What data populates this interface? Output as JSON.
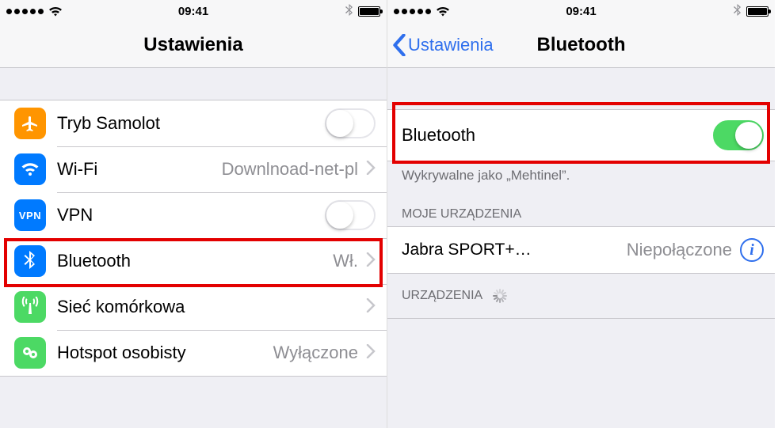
{
  "status": {
    "time": "09:41"
  },
  "left": {
    "title": "Ustawienia",
    "rows": {
      "airplane": {
        "label": "Tryb Samolot",
        "on": false
      },
      "wifi": {
        "label": "Wi-Fi",
        "value": "Downlnoad-net-pl"
      },
      "vpn": {
        "label": "VPN",
        "icon_text": "VPN",
        "on": false
      },
      "bluetooth": {
        "label": "Bluetooth",
        "value": "Wł."
      },
      "cell": {
        "label": "Sieć komórkowa"
      },
      "hotspot": {
        "label": "Hotspot osobisty",
        "value": "Wyłączone"
      }
    }
  },
  "right": {
    "back": "Ustawienia",
    "title": "Bluetooth",
    "toggle": {
      "label": "Bluetooth",
      "on": true
    },
    "discoverable": "Wykrywalne jako „Mehtinel”.",
    "my_devices_header": "MOJE URZĄDZENIA",
    "devices": [
      {
        "name": "Jabra SPORT+…",
        "status": "Niepołączone"
      }
    ],
    "other_devices_header": "URZĄDZENIA"
  }
}
